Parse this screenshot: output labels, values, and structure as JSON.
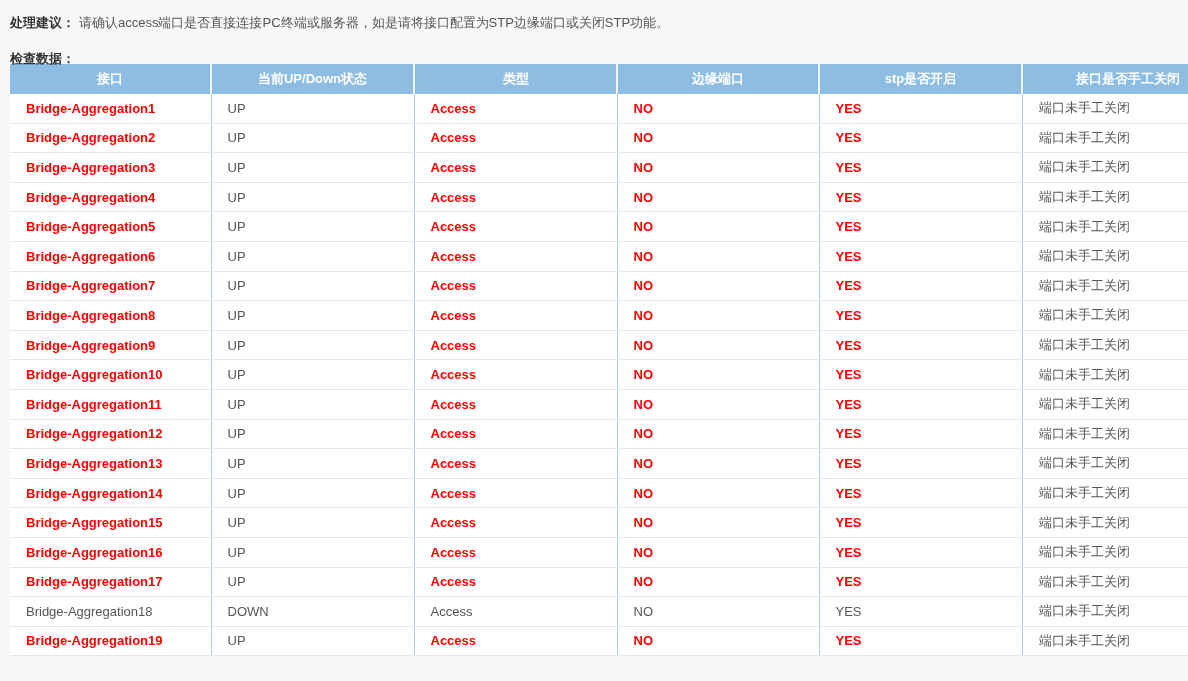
{
  "suggestion": {
    "label": "处理建议：",
    "text": "请确认access端口是否直接连接PC终端或服务器，如是请将接口配置为STP边缘端口或关闭STP功能。"
  },
  "section_title": "检查数据：",
  "table": {
    "columns": [
      "接口",
      "当前UP/Down状态",
      "类型",
      "边缘端口",
      "stp是否开启",
      "接口是否手工关闭"
    ],
    "rows": [
      {
        "highlight": true,
        "cells": [
          "Bridge-Aggregation1",
          "UP",
          "Access",
          "NO",
          "YES",
          "端口未手工关闭"
        ]
      },
      {
        "highlight": true,
        "cells": [
          "Bridge-Aggregation2",
          "UP",
          "Access",
          "NO",
          "YES",
          "端口未手工关闭"
        ]
      },
      {
        "highlight": true,
        "cells": [
          "Bridge-Aggregation3",
          "UP",
          "Access",
          "NO",
          "YES",
          "端口未手工关闭"
        ]
      },
      {
        "highlight": true,
        "cells": [
          "Bridge-Aggregation4",
          "UP",
          "Access",
          "NO",
          "YES",
          "端口未手工关闭"
        ]
      },
      {
        "highlight": true,
        "cells": [
          "Bridge-Aggregation5",
          "UP",
          "Access",
          "NO",
          "YES",
          "端口未手工关闭"
        ]
      },
      {
        "highlight": true,
        "cells": [
          "Bridge-Aggregation6",
          "UP",
          "Access",
          "NO",
          "YES",
          "端口未手工关闭"
        ]
      },
      {
        "highlight": true,
        "cells": [
          "Bridge-Aggregation7",
          "UP",
          "Access",
          "NO",
          "YES",
          "端口未手工关闭"
        ]
      },
      {
        "highlight": true,
        "cells": [
          "Bridge-Aggregation8",
          "UP",
          "Access",
          "NO",
          "YES",
          "端口未手工关闭"
        ]
      },
      {
        "highlight": true,
        "cells": [
          "Bridge-Aggregation9",
          "UP",
          "Access",
          "NO",
          "YES",
          "端口未手工关闭"
        ]
      },
      {
        "highlight": true,
        "cells": [
          "Bridge-Aggregation10",
          "UP",
          "Access",
          "NO",
          "YES",
          "端口未手工关闭"
        ]
      },
      {
        "highlight": true,
        "cells": [
          "Bridge-Aggregation11",
          "UP",
          "Access",
          "NO",
          "YES",
          "端口未手工关闭"
        ]
      },
      {
        "highlight": true,
        "cells": [
          "Bridge-Aggregation12",
          "UP",
          "Access",
          "NO",
          "YES",
          "端口未手工关闭"
        ]
      },
      {
        "highlight": true,
        "cells": [
          "Bridge-Aggregation13",
          "UP",
          "Access",
          "NO",
          "YES",
          "端口未手工关闭"
        ]
      },
      {
        "highlight": true,
        "cells": [
          "Bridge-Aggregation14",
          "UP",
          "Access",
          "NO",
          "YES",
          "端口未手工关闭"
        ]
      },
      {
        "highlight": true,
        "cells": [
          "Bridge-Aggregation15",
          "UP",
          "Access",
          "NO",
          "YES",
          "端口未手工关闭"
        ]
      },
      {
        "highlight": true,
        "cells": [
          "Bridge-Aggregation16",
          "UP",
          "Access",
          "NO",
          "YES",
          "端口未手工关闭"
        ]
      },
      {
        "highlight": true,
        "cells": [
          "Bridge-Aggregation17",
          "UP",
          "Access",
          "NO",
          "YES",
          "端口未手工关闭"
        ]
      },
      {
        "highlight": false,
        "cells": [
          "Bridge-Aggregation18",
          "DOWN",
          "Access",
          "NO",
          "YES",
          "端口未手工关闭"
        ]
      },
      {
        "highlight": true,
        "cells": [
          "Bridge-Aggregation19",
          "UP",
          "Access",
          "NO",
          "YES",
          "端口未手工关闭"
        ]
      }
    ]
  }
}
